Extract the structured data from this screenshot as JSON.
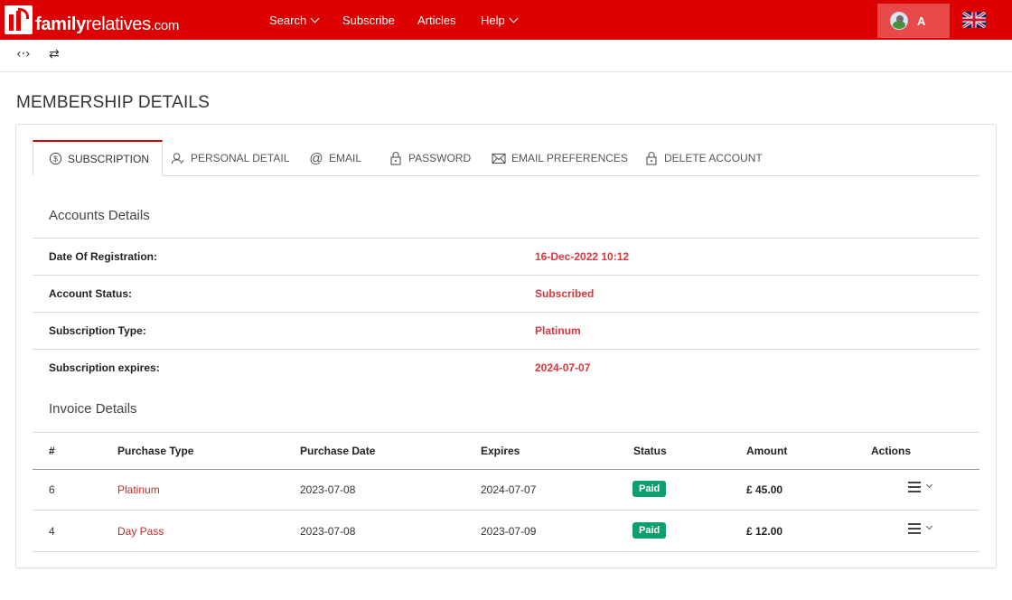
{
  "brand": {
    "bold": "family",
    "light": "relatives",
    "tld": ".com"
  },
  "nav": {
    "search": "Search",
    "subscribe": "Subscribe",
    "articles": "Articles",
    "help": "Help"
  },
  "user": {
    "initial": "A"
  },
  "toolbar": {
    "expand_icon": "‹·›",
    "swap_icon": "⇄"
  },
  "page": {
    "title": "MEMBERSHIP DETAILS"
  },
  "tabs": [
    {
      "label": "SUBSCRIPTION",
      "icon": "dollar-circle-icon"
    },
    {
      "label": "PERSONAL DETAIL",
      "icon": "user-edit-icon"
    },
    {
      "label": "EMAIL",
      "icon": "at-icon"
    },
    {
      "label": "PASSWORD",
      "icon": "lock-icon"
    },
    {
      "label": "EMAIL PREFERENCES",
      "icon": "envelope-icon"
    },
    {
      "label": "DELETE ACCOUNT",
      "icon": "lock-icon"
    }
  ],
  "accounts": {
    "title": "Accounts Details",
    "rows": [
      {
        "label": "Date Of Registration:",
        "value": "16-Dec-2022 10:12"
      },
      {
        "label": "Account Status:",
        "value": "Subscribed"
      },
      {
        "label": "Subscription Type:",
        "value": "Platinum"
      },
      {
        "label": "Subscription expires:",
        "value": "2024-07-07"
      }
    ]
  },
  "invoices": {
    "title": "Invoice Details",
    "headers": [
      "#",
      "Purchase Type",
      "Purchase Date",
      "Expires",
      "Status",
      "Amount",
      "Actions"
    ],
    "rows": [
      {
        "id": "6",
        "type": "Platinum",
        "date": "2023-07-08",
        "expires": "2024-07-07",
        "status": "Paid",
        "amount": "£ 45.00"
      },
      {
        "id": "4",
        "type": "Day Pass",
        "date": "2023-07-08",
        "expires": "2023-07-09",
        "status": "Paid",
        "amount": "£ 12.00"
      }
    ]
  },
  "colors": {
    "brand_red": "#dd0000",
    "value_red": "#d9363e",
    "paid_green": "#0e9f6e"
  }
}
